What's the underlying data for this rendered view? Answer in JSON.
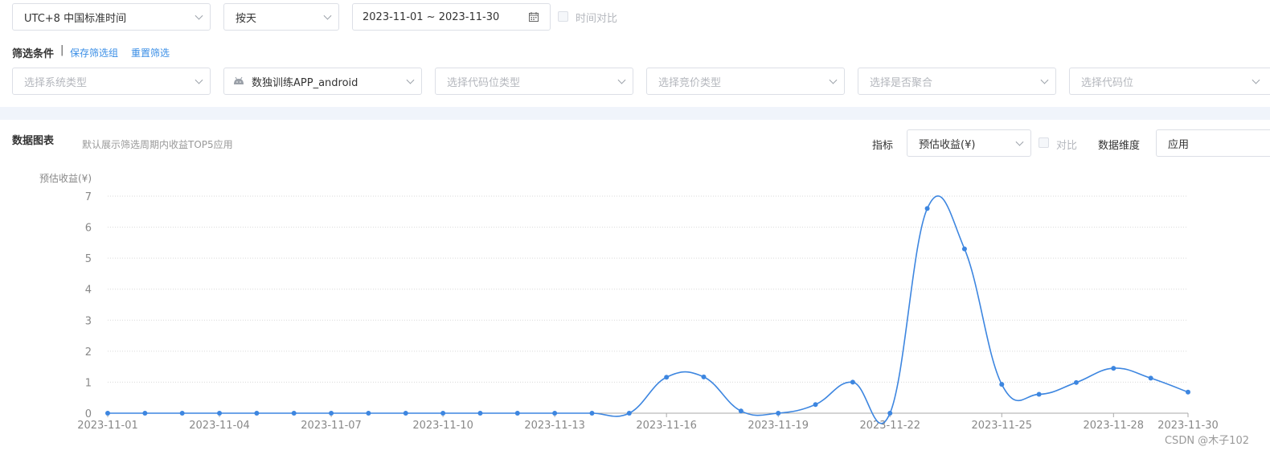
{
  "toolbar": {
    "timezone": "UTC+8 中国标准时间",
    "granularity": "按天",
    "date_range": "2023-11-01 ~ 2023-11-30",
    "time_compare_label": "时间对比"
  },
  "filters": {
    "title": "筛选条件",
    "separator": "|",
    "save_link": "保存筛选组",
    "reset_link": "重置筛选",
    "system_placeholder": "选择系统类型",
    "app_value": "数独训练APP_android",
    "slot_type_placeholder": "选择代码位类型",
    "bid_type_placeholder": "选择竞价类型",
    "aggregate_placeholder": "选择是否聚合",
    "slot_placeholder": "选择代码位"
  },
  "chart_section": {
    "title": "数据图表",
    "hint": "默认展示筛选周期内收益TOP5应用",
    "metric_label": "指标",
    "metric_value": "预估收益(¥)",
    "compare_label": "对比",
    "dimension_label": "数据维度",
    "dimension_value": "应用"
  },
  "chart_data": {
    "type": "line",
    "ylabel": "预估收益(¥)",
    "ylim": [
      0,
      7
    ],
    "yticks": [
      0,
      1,
      2,
      3,
      4,
      5,
      6,
      7
    ],
    "xticks": [
      "2023-11-01",
      "2023-11-04",
      "2023-11-07",
      "2023-11-10",
      "2023-11-13",
      "2023-11-16",
      "2023-11-19",
      "2023-11-22",
      "2023-11-25",
      "2023-11-28",
      "2023-11-30"
    ],
    "x": [
      "2023-11-01",
      "2023-11-02",
      "2023-11-03",
      "2023-11-04",
      "2023-11-05",
      "2023-11-06",
      "2023-11-07",
      "2023-11-08",
      "2023-11-09",
      "2023-11-10",
      "2023-11-11",
      "2023-11-12",
      "2023-11-13",
      "2023-11-14",
      "2023-11-15",
      "2023-11-16",
      "2023-11-17",
      "2023-11-18",
      "2023-11-19",
      "2023-11-20",
      "2023-11-21",
      "2023-11-22",
      "2023-11-23",
      "2023-11-24",
      "2023-11-25",
      "2023-11-26",
      "2023-11-27",
      "2023-11-28",
      "2023-11-29",
      "2023-11-30"
    ],
    "series": [
      {
        "values": [
          0,
          0,
          0,
          0,
          0,
          0,
          0,
          0,
          0,
          0,
          0,
          0,
          0,
          0,
          0,
          1.16,
          1.17,
          0.07,
          0,
          0.28,
          1.0,
          0,
          6.6,
          5.3,
          0.93,
          0.61,
          0.99,
          1.45,
          1.13,
          0.68
        ],
        "color": "#3d86e0"
      }
    ],
    "grid": true
  },
  "watermark": "CSDN @木子102"
}
